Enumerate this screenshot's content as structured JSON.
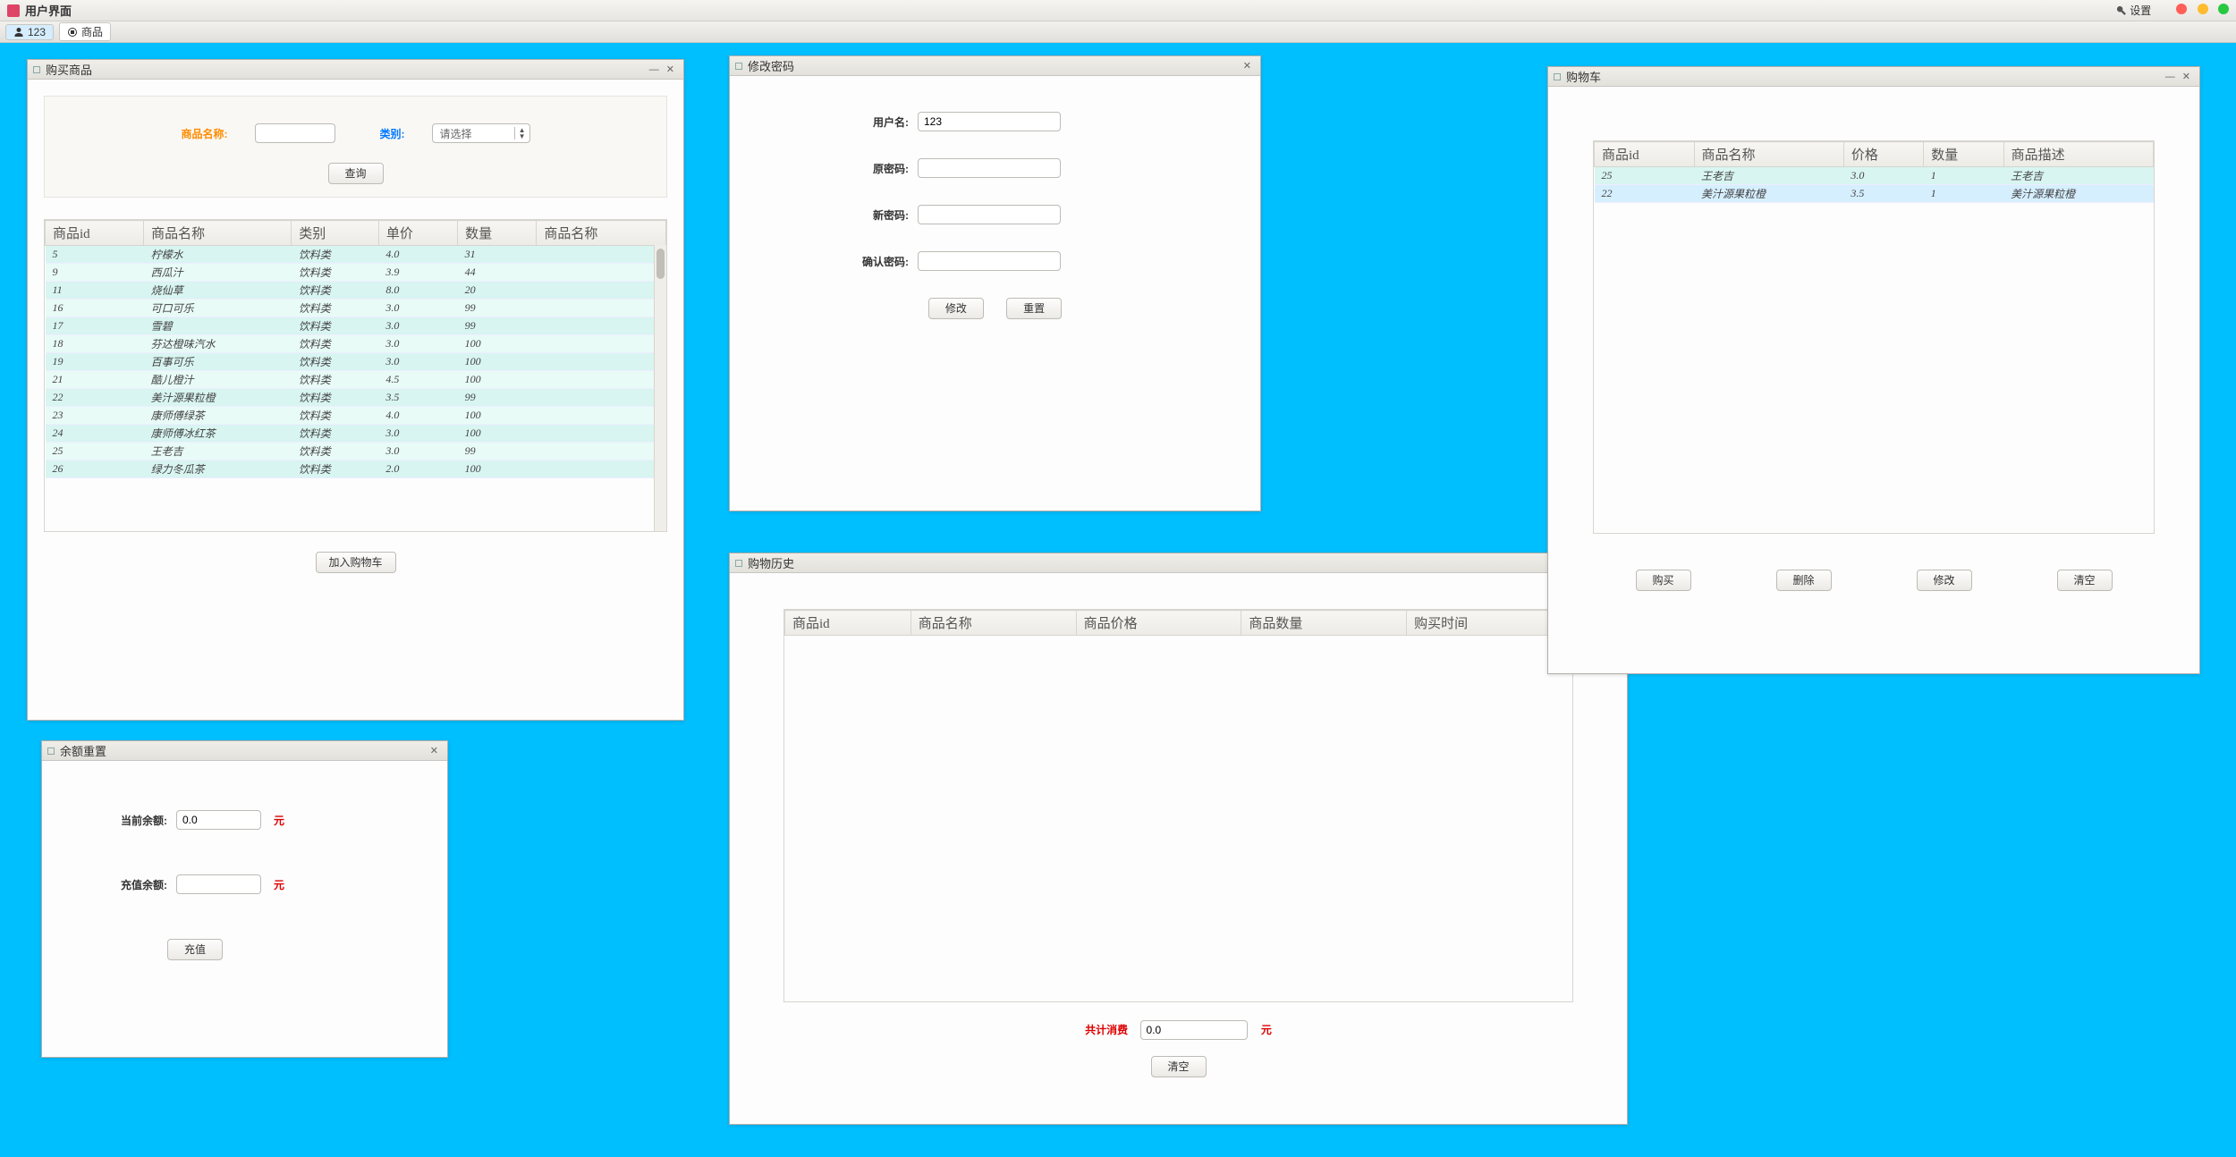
{
  "window": {
    "title": "用户界面",
    "settings": "设置"
  },
  "toolbar": {
    "user_chip": "123",
    "product_chip": "商品"
  },
  "buy": {
    "title": "购买商品",
    "label_name": "商品名称:",
    "label_category": "类别:",
    "category_placeholder": "请选择",
    "btn_search": "查询",
    "btn_add_cart": "加入购物车",
    "columns": [
      "商品id",
      "商品名称",
      "类别",
      "单价",
      "数量",
      "商品名称"
    ],
    "rows": [
      {
        "id": "5",
        "name": "柠檬水",
        "cat": "饮料类",
        "price": "4.0",
        "qty": "31"
      },
      {
        "id": "9",
        "name": "西瓜汁",
        "cat": "饮料类",
        "price": "3.9",
        "qty": "44"
      },
      {
        "id": "11",
        "name": "烧仙草",
        "cat": "饮料类",
        "price": "8.0",
        "qty": "20"
      },
      {
        "id": "16",
        "name": "可口可乐",
        "cat": "饮料类",
        "price": "3.0",
        "qty": "99"
      },
      {
        "id": "17",
        "name": "雪碧",
        "cat": "饮料类",
        "price": "3.0",
        "qty": "99"
      },
      {
        "id": "18",
        "name": "芬达橙味汽水",
        "cat": "饮料类",
        "price": "3.0",
        "qty": "100"
      },
      {
        "id": "19",
        "name": "百事可乐",
        "cat": "饮料类",
        "price": "3.0",
        "qty": "100"
      },
      {
        "id": "21",
        "name": "酷儿橙汁",
        "cat": "饮料类",
        "price": "4.5",
        "qty": "100"
      },
      {
        "id": "22",
        "name": "美汁源果粒橙",
        "cat": "饮料类",
        "price": "3.5",
        "qty": "99"
      },
      {
        "id": "23",
        "name": "康师傅绿茶",
        "cat": "饮料类",
        "price": "4.0",
        "qty": "100"
      },
      {
        "id": "24",
        "name": "康师傅冰红茶",
        "cat": "饮料类",
        "price": "3.0",
        "qty": "100"
      },
      {
        "id": "25",
        "name": "王老吉",
        "cat": "饮料类",
        "price": "3.0",
        "qty": "99"
      },
      {
        "id": "26",
        "name": "绿力冬瓜茶",
        "cat": "饮料类",
        "price": "2.0",
        "qty": "100"
      }
    ]
  },
  "pwd": {
    "title": "修改密码",
    "label_user": "用户名:",
    "label_old": "原密码:",
    "label_new": "新密码:",
    "label_confirm": "确认密码:",
    "value_user": "123",
    "btn_modify": "修改",
    "btn_reset": "重置"
  },
  "balance": {
    "title": "余额重置",
    "label_current": "当前余额:",
    "label_recharge": "充值余额:",
    "unit": "元",
    "value_current": "0.0",
    "btn_recharge": "充值"
  },
  "history": {
    "title": "购物历史",
    "columns": [
      "商品id",
      "商品名称",
      "商品价格",
      "商品数量",
      "购买时间"
    ],
    "label_total": "共计消费",
    "value_total": "0.0",
    "unit": "元",
    "btn_clear": "清空"
  },
  "cart": {
    "title": "购物车",
    "columns": [
      "商品id",
      "商品名称",
      "价格",
      "数量",
      "商品描述"
    ],
    "rows": [
      {
        "id": "25",
        "name": "王老吉",
        "price": "3.0",
        "qty": "1",
        "desc": "王老吉"
      },
      {
        "id": "22",
        "name": "美汁源果粒橙",
        "price": "3.5",
        "qty": "1",
        "desc": "美汁源果粒橙"
      }
    ],
    "btn_buy": "购买",
    "btn_delete": "删除",
    "btn_modify": "修改",
    "btn_clear": "清空"
  }
}
